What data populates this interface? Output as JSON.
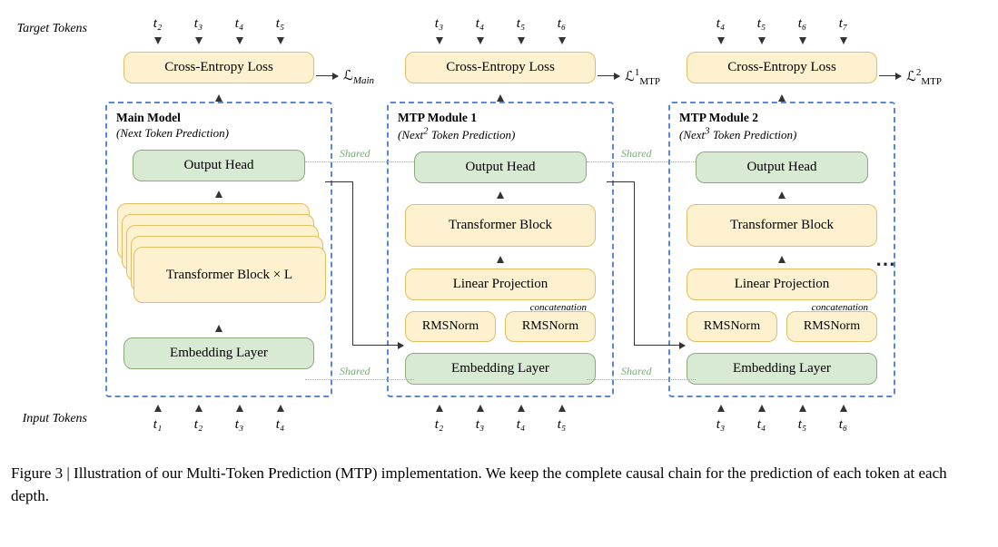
{
  "labels": {
    "target_tokens": "Target Tokens",
    "input_tokens": "Input Tokens"
  },
  "columns": [
    {
      "title_bold": "Main Model",
      "title_sub": "(Next Token Prediction)",
      "target_tokens": [
        "t₂",
        "t₃",
        "t₄",
        "t₅"
      ],
      "input_tokens": [
        "t₁",
        "t₂",
        "t₃",
        "t₄"
      ],
      "loss_label_html": "ℒ<sub style='font-style:italic'>Main</sub>",
      "output_head": "Output Head",
      "transformer": "Transformer Block × L",
      "embedding": "Embedding Layer",
      "ce_loss": "Cross-Entropy Loss"
    },
    {
      "title_bold": "MTP Module 1",
      "title_sub_html": "(Next<sup>2</sup> Token Prediction)",
      "target_tokens": [
        "t₃",
        "t₄",
        "t₅",
        "t₆"
      ],
      "input_tokens": [
        "t₂",
        "t₃",
        "t₄",
        "t₅"
      ],
      "loss_label_html": "ℒ<sup>1</sup><sub>MTP</sub>",
      "output_head": "Output Head",
      "transformer": "Transformer Block",
      "linear_proj": "Linear Projection",
      "concat": "concatenation",
      "rms": "RMSNorm",
      "embedding": "Embedding Layer",
      "ce_loss": "Cross-Entropy Loss"
    },
    {
      "title_bold": "MTP Module 2",
      "title_sub_html": "(Next<sup>3</sup> Token Prediction)",
      "target_tokens": [
        "t₄",
        "t₅",
        "t₆",
        "t₇"
      ],
      "input_tokens": [
        "t₃",
        "t₄",
        "t₅",
        "t₆"
      ],
      "loss_label_html": "ℒ<sup>2</sup><sub>MTP</sub>",
      "output_head": "Output Head",
      "transformer": "Transformer Block",
      "linear_proj": "Linear Projection",
      "concat": "concatenation",
      "rms": "RMSNorm",
      "embedding": "Embedding Layer",
      "ce_loss": "Cross-Entropy Loss"
    }
  ],
  "shared_label": "Shared",
  "ellipsis": "⋯",
  "caption": "Figure 3 | Illustration of our Multi-Token Prediction (MTP) implementation. We keep the complete causal chain for the prediction of each token at each depth."
}
